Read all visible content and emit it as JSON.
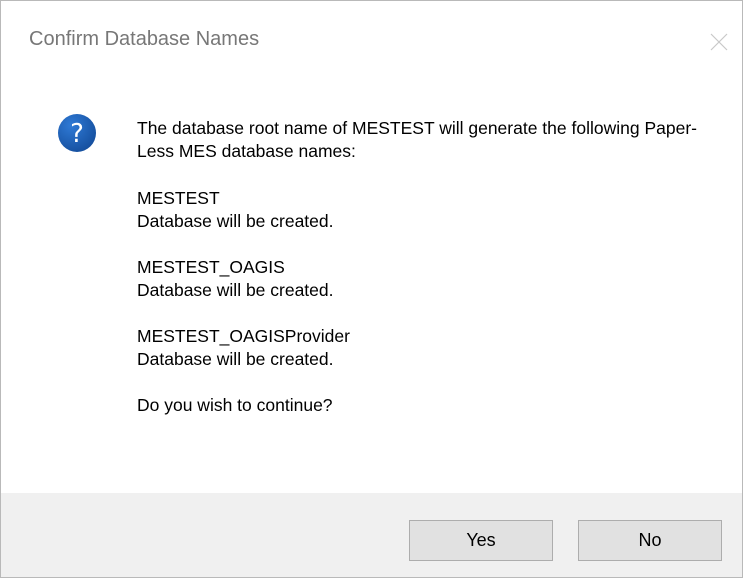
{
  "dialog": {
    "title": "Confirm Database Names",
    "icons": {
      "close": "close-icon",
      "message": "question-icon"
    },
    "message": {
      "intro": "The database root name of MESTEST will generate the following Paper-Less MES database names:",
      "databases": [
        {
          "name": "MESTEST",
          "status": "Database will be created."
        },
        {
          "name": "MESTEST_OAGIS",
          "status": "Database will be created."
        },
        {
          "name": "MESTEST_OAGISProvider",
          "status": "Database will be created."
        }
      ],
      "question": "Do you wish to continue?"
    },
    "buttons": {
      "yes": "Yes",
      "no": "No"
    },
    "colors": {
      "icon_blue": "#1c5fb8",
      "footer_bg": "#f0f0f0"
    }
  }
}
